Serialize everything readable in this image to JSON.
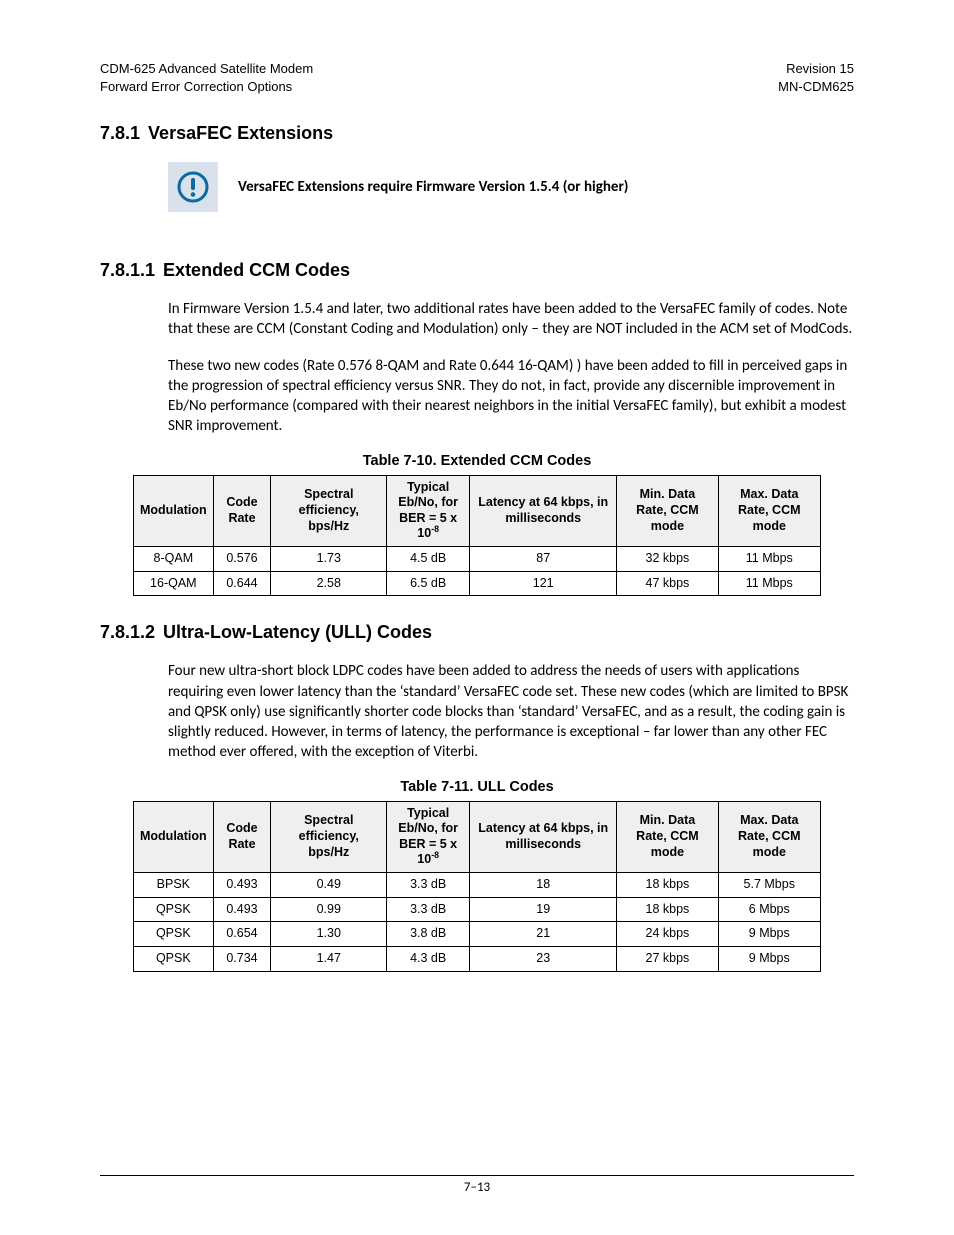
{
  "header": {
    "leftLine1": "CDM-625 Advanced Satellite Modem",
    "leftLine2": "Forward Error Correction Options",
    "rightLine1": "Revision 15",
    "rightLine2": "MN-CDM625"
  },
  "sec781": {
    "num": "7.8.1",
    "title": "VersaFEC Extensions",
    "noticeText": "VersaFEC Extensions require Firmware Version 1.5.4 (or higher)"
  },
  "sec7811": {
    "num": "7.8.1.1",
    "title": "Extended CCM Codes",
    "para1": "In Firmware Version 1.5.4 and later, two additional rates have been added to the VersaFEC family of codes. Note that these are CCM (Constant Coding and Modulation) only – they are NOT included in the ACM set of ModCods.",
    "para2": "These two new codes (Rate 0.576 8-QAM and Rate 0.644 16-QAM) ) have been added to fill in perceived gaps in the progression of spectral efficiency versus SNR. They do not, in fact,  provide any discernible improvement in Eb/No performance (compared with their nearest neighbors in the initial VersaFEC family), but exhibit a modest SNR improvement."
  },
  "table710": {
    "caption": "Table 7-10. Extended CCM Codes",
    "headers": {
      "h0": "Modulation",
      "h1": "Code Rate",
      "h2": "Spectral efficiency, bps/Hz",
      "h3a": "Typical Eb/No, for",
      "h3b": "BER = 5 x 10",
      "h3c": "-8",
      "h4": "Latency at 64 kbps, in milliseconds",
      "h5": "Min. Data Rate, CCM mode",
      "h6": "Max. Data Rate, CCM mode"
    },
    "rows": [
      {
        "c0": "8-QAM",
        "c1": "0.576",
        "c2": "1.73",
        "c3": "4.5 dB",
        "c4": "87",
        "c5": "32 kbps",
        "c6": "11 Mbps"
      },
      {
        "c0": "16-QAM",
        "c1": "0.644",
        "c2": "2.58",
        "c3": "6.5 dB",
        "c4": "121",
        "c5": "47 kbps",
        "c6": "11 Mbps"
      }
    ]
  },
  "sec7812": {
    "num": "7.8.1.2",
    "title": "Ultra-Low-Latency (ULL) Codes",
    "para1": "Four new ultra-short block LDPC codes have been added to address the needs of users with applications requiring even lower latency than the ‘standard’ VersaFEC code set. These new codes (which are limited to BPSK and QPSK only) use significantly shorter code blocks than ‘standard’ VersaFEC, and as a result, the coding gain is slightly reduced. However, in terms of latency, the performance is exceptional – far lower than any other FEC method ever offered, with the exception of Viterbi."
  },
  "table711": {
    "caption": "Table 7-11. ULL Codes",
    "headers": {
      "h0": "Modulation",
      "h1": "Code Rate",
      "h2": "Spectral efficiency, bps/Hz",
      "h3a": "Typical Eb/No, for",
      "h3b": "BER = 5 x 10",
      "h3c": "-8",
      "h4": "Latency at 64 kbps, in milliseconds",
      "h5": "Min. Data Rate, CCM mode",
      "h6": "Max. Data Rate, CCM mode"
    },
    "rows": [
      {
        "c0": "BPSK",
        "c1": "0.493",
        "c2": "0.49",
        "c3": "3.3 dB",
        "c4": "18",
        "c5": "18 kbps",
        "c6": "5.7 Mbps"
      },
      {
        "c0": "QPSK",
        "c1": "0.493",
        "c2": "0.99",
        "c3": "3.3 dB",
        "c4": "19",
        "c5": "18 kbps",
        "c6": "6 Mbps"
      },
      {
        "c0": "QPSK",
        "c1": "0.654",
        "c2": "1.30",
        "c3": "3.8 dB",
        "c4": "21",
        "c5": "24 kbps",
        "c6": "9 Mbps"
      },
      {
        "c0": "QPSK",
        "c1": "0.734",
        "c2": "1.47",
        "c3": "4.3 dB",
        "c4": "23",
        "c5": "27 kbps",
        "c6": "9 Mbps"
      }
    ]
  },
  "footer": {
    "pageNum": "7–13"
  }
}
